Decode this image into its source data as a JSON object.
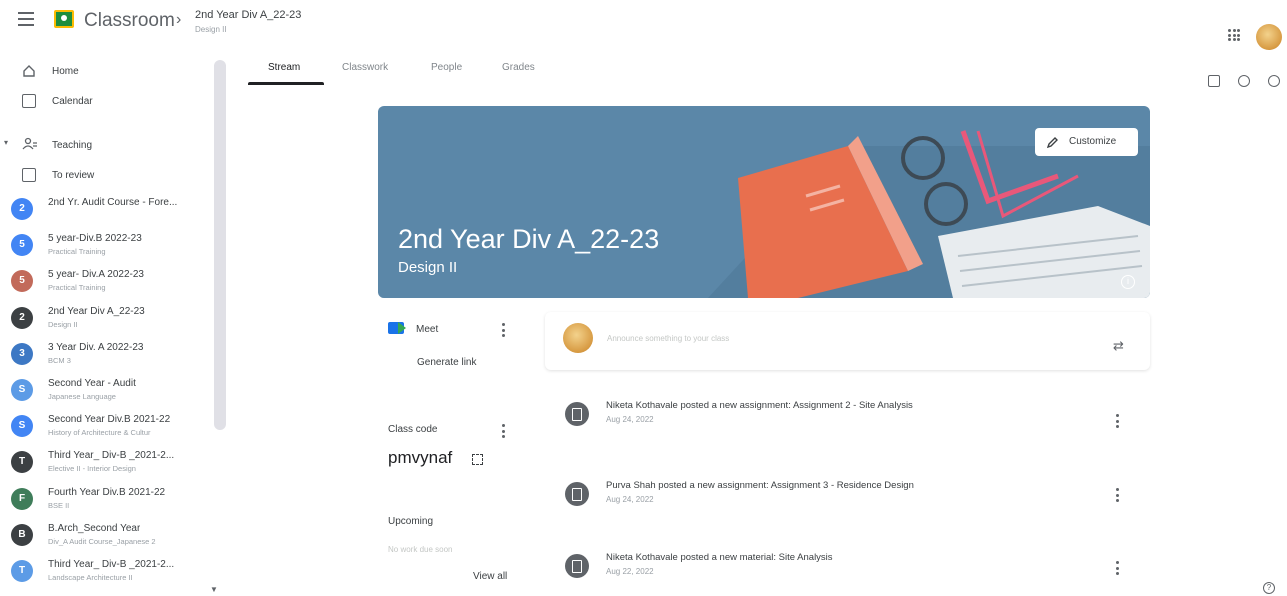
{
  "header": {
    "app_title": "Classroom",
    "crumb_separator": "›",
    "class_title": "2nd Year Div A_22-23",
    "class_subtitle": "Design II"
  },
  "sidebar": {
    "items": [
      {
        "label": "Home",
        "icon": "home-icon"
      },
      {
        "label": "Calendar",
        "icon": "calendar-icon"
      },
      {
        "label": "Teaching",
        "icon": "people-icon"
      },
      {
        "label": "To review",
        "icon": "review-icon"
      }
    ],
    "courses": [
      {
        "initial": "2",
        "name": "2nd Yr. Audit Course - Fore...",
        "section": "",
        "color": "#4285f4"
      },
      {
        "initial": "5",
        "name": "5 year-Div.B 2022-23",
        "section": "Practical Training",
        "color": "#4285f4"
      },
      {
        "initial": "5",
        "name": "5 year- Div.A 2022-23",
        "section": "Practical Training",
        "color": "#c26a5a"
      },
      {
        "initial": "2",
        "name": "2nd Year Div A_22-23",
        "section": "Design II",
        "color": "#3c4043"
      },
      {
        "initial": "3",
        "name": "3 Year Div. A 2022-23",
        "section": "BCM 3",
        "color": "#3d78c4"
      },
      {
        "initial": "S",
        "name": "Second Year - Audit",
        "section": "Japanese Language",
        "color": "#5c9be6"
      },
      {
        "initial": "S",
        "name": "Second Year Div.B 2021-22",
        "section": "History of Architecture & Cultur",
        "color": "#4285f4"
      },
      {
        "initial": "T",
        "name": "Third Year_ Div-B _2021-2...",
        "section": "Elective II - Interior Design",
        "color": "#3c4043"
      },
      {
        "initial": "F",
        "name": "Fourth Year Div.B 2021-22",
        "section": "BSE II",
        "color": "#3f7d5a"
      },
      {
        "initial": "B",
        "name": "B.Arch_Second Year",
        "section": "Div_A Audit Course_Japanese 2",
        "color": "#3c4043"
      },
      {
        "initial": "T",
        "name": "Third Year_ Div-B _2021-2...",
        "section": "Landscape Architecture II",
        "color": "#5c9be6"
      }
    ]
  },
  "tabs": [
    {
      "label": "Stream",
      "active": true
    },
    {
      "label": "Classwork",
      "active": false
    },
    {
      "label": "People",
      "active": false
    },
    {
      "label": "Grades",
      "active": false
    }
  ],
  "banner": {
    "title": "2nd Year Div A_22-23",
    "subtitle": "Design II",
    "customize_label": "Customize",
    "color": "#5b87a8"
  },
  "meet": {
    "label": "Meet",
    "generate_link": "Generate link"
  },
  "class_code": {
    "label": "Class code",
    "value": "pmvynaf"
  },
  "upcoming": {
    "label": "Upcoming",
    "empty_text": "No work due soon",
    "view_all": "View all"
  },
  "announce": {
    "placeholder": "Announce something to your class"
  },
  "posts": [
    {
      "title": "Niketa Kothavale posted a new assignment: Assignment 2 - Site Analysis",
      "date": "Aug 24, 2022",
      "icon": "assignment-icon"
    },
    {
      "title": "Purva Shah posted a new assignment: Assignment 3 - Residence Design",
      "date": "Aug 24, 2022",
      "icon": "assignment-icon"
    },
    {
      "title": "Niketa Kothavale posted a new material: Site Analysis",
      "date": "Aug 22, 2022",
      "icon": "material-icon"
    }
  ]
}
